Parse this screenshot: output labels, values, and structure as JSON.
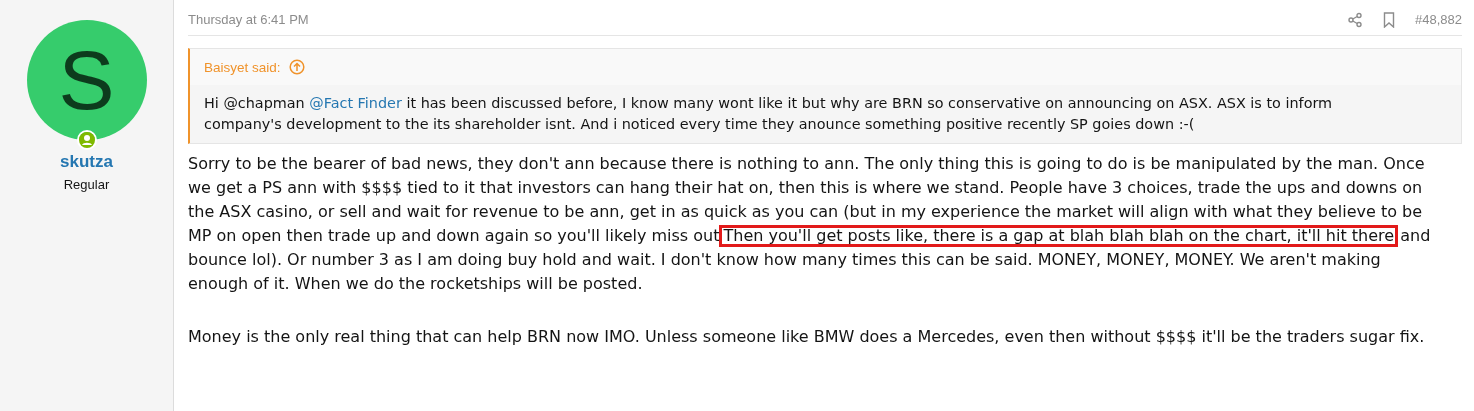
{
  "author": {
    "avatar_letter": "S",
    "name": "skutza",
    "title": "Regular",
    "online": true
  },
  "post": {
    "date": "Thursday at 6:41 PM",
    "number": "#48,882",
    "quote": {
      "source": "Baisyet said:",
      "parts": [
        {
          "text": "Hi @chapman ",
          "kind": "plain"
        },
        {
          "text": "@Fact Finder",
          "kind": "mention"
        },
        {
          "text": " it has been discussed before, I know many wont like it but why are BRN so conservative on announcing on ASX. ASX is to inform company's development to the its shareholder isnt. And i noticed every time they anounce something positive recently SP goies down :-(",
          "kind": "plain"
        }
      ]
    },
    "paragraphs": [
      {
        "parts": [
          {
            "text": "Sorry to be the bearer of bad news, they don't ann because there is nothing to ann. The only thing this is going to do is be manipulated by the man. Once we get a PS ann with $$$$ tied to it that investors can hang their hat on, then this is where we stand. People have 3 choices, trade the ups and downs on the ASX casino, or sell and wait for revenue to be ann, get in as quick as you can (but in my experience the market will align with what they believe to be MP on open then trade up and down again so you'll likely miss out"
          },
          {
            "text": "Then you'll get posts like, there is a gap at blah blah blah on the chart, it'll hit there",
            "highlighted": true
          },
          {
            "text": " and bounce lol). Or number 3 as I am doing buy hold and wait. I don't know how many times this can be said. MONEY, MONEY, MONEY. We aren't making enough of it. When we do the rocketships will be posted."
          }
        ]
      },
      {
        "parts": [
          {
            "text": "Money is the only real thing that can help BRN now IMO. Unless someone like BMW does a Mercedes, even then without $$$$ it'll be the traders sugar fix."
          }
        ]
      }
    ]
  }
}
